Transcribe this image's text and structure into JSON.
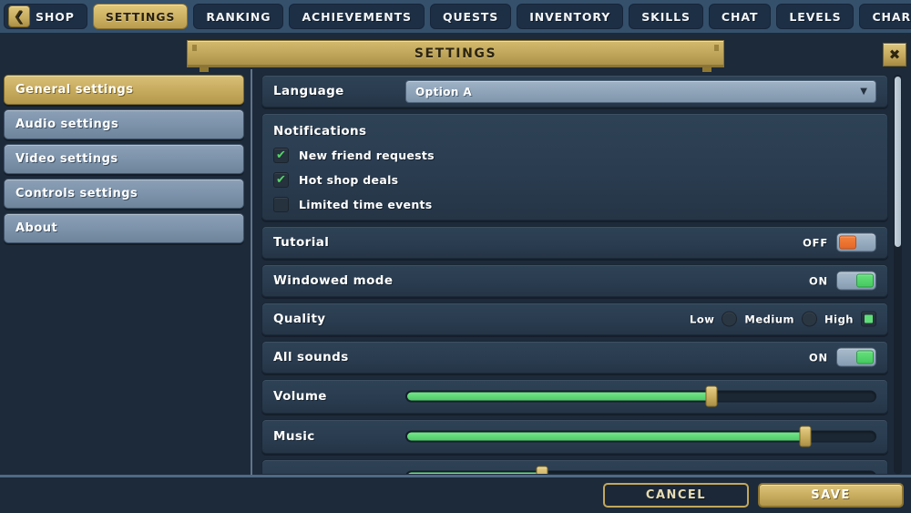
{
  "tabs": [
    {
      "label": "SHOP",
      "active": false,
      "arrow": "left",
      "arrow_icon": "❮"
    },
    {
      "label": "SETTINGS",
      "active": true,
      "arrow": "none"
    },
    {
      "label": "RANKING",
      "active": false,
      "arrow": "none"
    },
    {
      "label": "ACHIEVEMENTS",
      "active": false,
      "arrow": "none"
    },
    {
      "label": "QUESTS",
      "active": false,
      "arrow": "none"
    },
    {
      "label": "INVENTORY",
      "active": false,
      "arrow": "none"
    },
    {
      "label": "SKILLS",
      "active": false,
      "arrow": "none"
    },
    {
      "label": "CHAT",
      "active": false,
      "arrow": "none"
    },
    {
      "label": "LEVELS",
      "active": false,
      "arrow": "none"
    },
    {
      "label": "CHARACTER",
      "active": false,
      "arrow": "right",
      "arrow_icon": "❯"
    }
  ],
  "window": {
    "title": "SETTINGS",
    "close_icon": "✖"
  },
  "sidebar": {
    "items": [
      {
        "label": "General settings",
        "active": true
      },
      {
        "label": "Audio settings",
        "active": false
      },
      {
        "label": "Video settings",
        "active": false
      },
      {
        "label": "Controls settings",
        "active": false
      },
      {
        "label": "About",
        "active": false
      }
    ]
  },
  "settings": {
    "language": {
      "label": "Language",
      "value": "Option A",
      "caret_icon": "▼"
    },
    "notifications": {
      "title": "Notifications",
      "items": [
        {
          "label": "New friend requests",
          "checked": true,
          "check_icon": "✔"
        },
        {
          "label": "Hot shop deals",
          "checked": true,
          "check_icon": "✔"
        },
        {
          "label": "Limited time events",
          "checked": false,
          "check_icon": ""
        }
      ]
    },
    "tutorial": {
      "label": "Tutorial",
      "state": "OFF",
      "on": false
    },
    "windowed_mode": {
      "label": "Windowed mode",
      "state": "ON",
      "on": true
    },
    "quality": {
      "label": "Quality",
      "options": [
        {
          "label": "Low",
          "selected": false
        },
        {
          "label": "Medium",
          "selected": false
        },
        {
          "label": "High",
          "selected": true
        }
      ]
    },
    "all_sounds": {
      "label": "All sounds",
      "state": "ON",
      "on": true
    },
    "volume": {
      "label": "Volume",
      "percent": 65
    },
    "music": {
      "label": "Music",
      "percent": 85
    },
    "partial_slider": {
      "percent": 29
    }
  },
  "scrollbar": {
    "thumb_percent": 43
  },
  "footer": {
    "cancel_label": "CANCEL",
    "save_label": "SAVE"
  },
  "colors": {
    "background": "#1d2a3a",
    "tabbar": "#35506b",
    "gold": "#c2a85c",
    "green": "#4fc968",
    "orange": "#e5682a",
    "row": "#2a3c50"
  }
}
